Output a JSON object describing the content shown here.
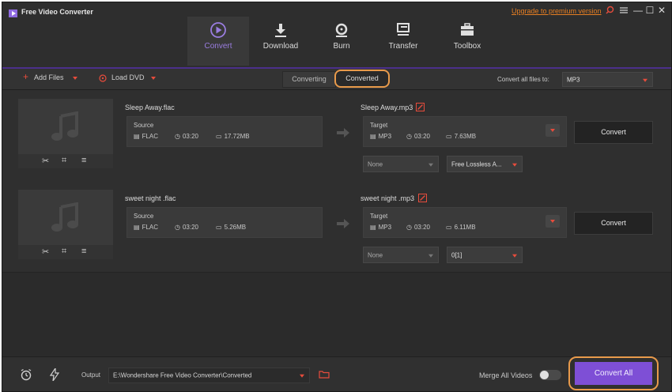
{
  "app": {
    "title": "Free Video Converter",
    "upgrade_link": "Upgrade to premium version"
  },
  "window_controls": {
    "search_icon": "search-icon",
    "menu_icon": "menu-icon",
    "minimize": "—",
    "maximize": "☐",
    "close": "✕"
  },
  "nav": {
    "tabs": [
      {
        "label": "Convert",
        "icon": "convert-icon",
        "active": true
      },
      {
        "label": "Download",
        "icon": "download-icon",
        "active": false
      },
      {
        "label": "Burn",
        "icon": "burn-icon",
        "active": false
      },
      {
        "label": "Transfer",
        "icon": "transfer-icon",
        "active": false
      },
      {
        "label": "Toolbox",
        "icon": "toolbox-icon",
        "active": false
      }
    ]
  },
  "toolbar": {
    "add_files": "Add Files",
    "load_dvd": "Load DVD",
    "converting_tab": "Converting",
    "converted_tab": "Converted",
    "convert_all_to_label": "Convert all files to:",
    "convert_all_to_value": "MP3"
  },
  "files": [
    {
      "name": "Sleep Away.flac",
      "source_label": "Source",
      "source_format": "FLAC",
      "source_duration": "03:20",
      "source_size": "17.72MB",
      "target_name": "Sleep Away.mp3",
      "target_label": "Target",
      "target_format": "MP3",
      "target_duration": "03:20",
      "target_size": "7.63MB",
      "subtitle_option": "None",
      "audio_option": "Free Lossless A...",
      "convert_label": "Convert"
    },
    {
      "name": "sweet night .flac",
      "source_label": "Source",
      "source_format": "FLAC",
      "source_duration": "03:20",
      "source_size": "5.26MB",
      "target_name": "sweet night .mp3",
      "target_label": "Target",
      "target_format": "MP3",
      "target_duration": "03:20",
      "target_size": "6.11MB",
      "subtitle_option": "None",
      "audio_option": "0[1]",
      "convert_label": "Convert"
    }
  ],
  "bottom": {
    "output_label": "Output",
    "output_path": "E:\\Wondershare Free Video Converter\\Converted",
    "merge_label": "Merge All Videos",
    "merge_on": false,
    "convert_all": "Convert All"
  },
  "colors": {
    "accent": "#7e4fd6",
    "highlight_ring": "#e89a4b",
    "caret": "#e74c3c",
    "upgrade": "#e67e22"
  }
}
